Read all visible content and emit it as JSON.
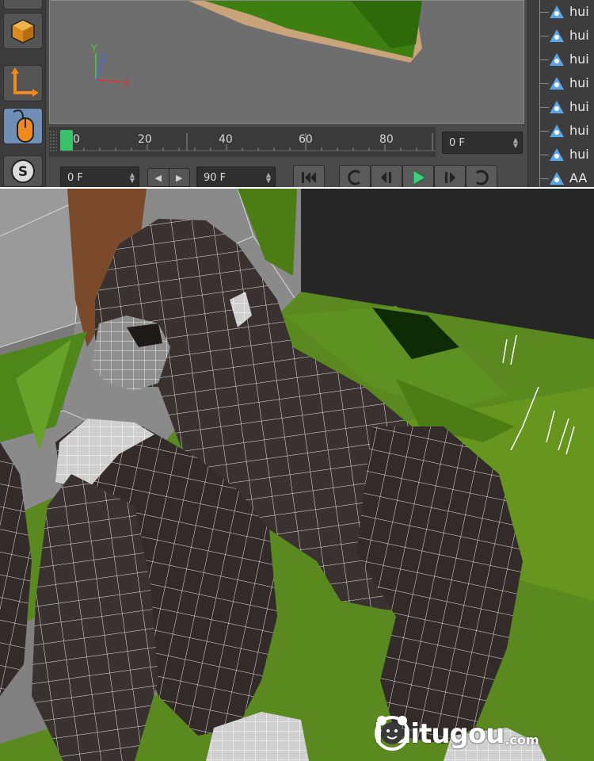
{
  "timeline": {
    "ticks": [
      "0",
      "20",
      "40",
      "60",
      "80"
    ],
    "current_frame": "0 F",
    "start_frame": "0 F",
    "end_frame": "90 F"
  },
  "transport": {
    "first_icon": "skip-to-start-icon",
    "prev_key_icon": "previous-keyframe-icon",
    "prev_frame_icon": "previous-frame-icon",
    "play_icon": "play-icon",
    "next_frame_icon": "next-frame-icon",
    "next_key_icon": "next-keyframe-icon"
  },
  "axis_gizmo": {
    "x": "X",
    "y": "Y",
    "z": "Z"
  },
  "object_tree": {
    "items": [
      "hui",
      "hui",
      "hui",
      "hui",
      "hui",
      "hui",
      "hui",
      "AA"
    ]
  },
  "tools": {
    "snap_label": "S"
  },
  "watermark": {
    "brand": "huitugou",
    "domain": ".com"
  },
  "colors": {
    "playhead": "#39c26a",
    "play_button": "#3ecf7a",
    "tool_active": "#6f8fb6",
    "joint_icon": "#59a6e8",
    "gorilla_fur": "#3a3230",
    "grass": "#5a8a1f"
  }
}
